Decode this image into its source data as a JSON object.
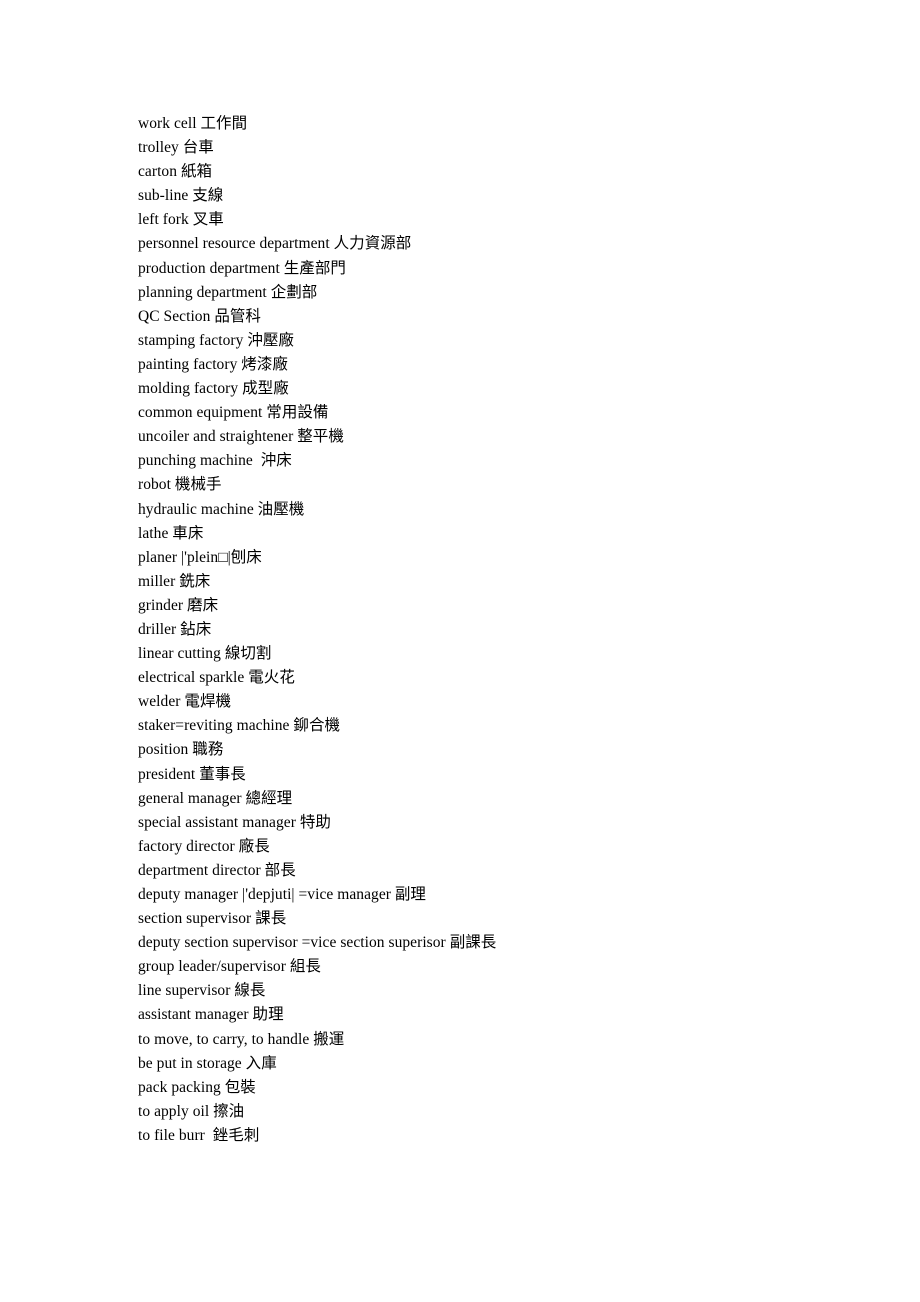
{
  "document": {
    "page_background": "#ffffff",
    "text_color": "#000000",
    "entries": [
      "work cell 工作間",
      "trolley 台車",
      "carton 紙箱",
      "sub-line 支線",
      "left fork 叉車",
      "personnel resource department 人力資源部",
      "production department 生產部門",
      "planning department 企劃部",
      "QC Section 品管科",
      "stamping factory 沖壓廠",
      "painting factory 烤漆廠",
      "molding factory 成型廠",
      "common equipment 常用設備",
      "uncoiler and straightener 整平機",
      "punching machine  沖床",
      "robot 機械手",
      "hydraulic machine 油壓機",
      "lathe 車床",
      "planer |'plein□|刨床",
      "miller 銑床",
      "grinder 磨床",
      "driller 鉆床",
      "linear cutting 線切割",
      "electrical sparkle 電火花",
      "welder 電焊機",
      "staker=reviting machine 鉚合機",
      "position 職務",
      "president 董事長",
      "general manager 總經理",
      "special assistant manager 特助",
      "factory director 廠長",
      "department director 部長",
      "deputy manager |'depjuti| =vice manager 副理",
      "section supervisor 課長",
      "deputy section supervisor =vice section superisor 副課長",
      "group leader/supervisor 組長",
      "line supervisor 線長",
      "assistant manager 助理",
      "to move, to carry, to handle 搬運",
      "be put in storage 入庫",
      "pack packing 包裝",
      "to apply oil 擦油",
      "to file burr  銼毛刺"
    ]
  }
}
